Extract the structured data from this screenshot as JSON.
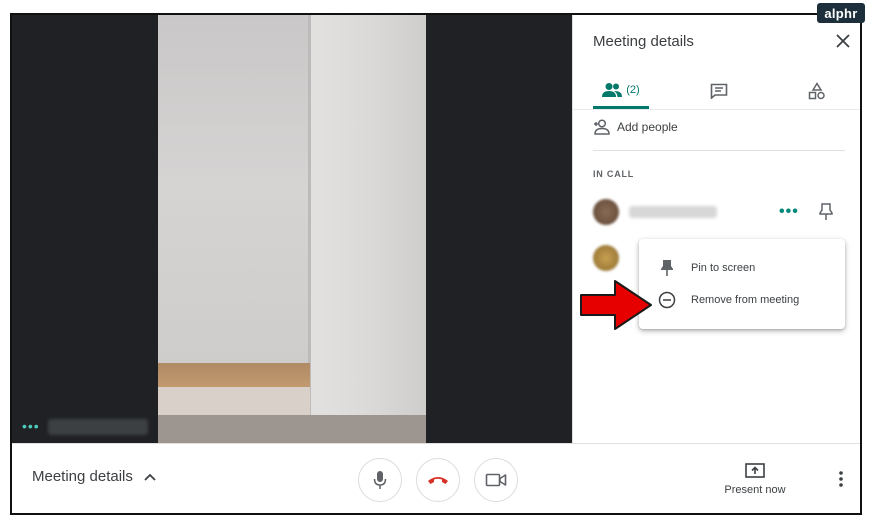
{
  "watermark": "alphr",
  "stage": {
    "participant_dots": "•••"
  },
  "panel": {
    "title": "Meeting details",
    "tabs": {
      "people_count": "(2)"
    },
    "add_people_label": "Add people",
    "section_label": "IN CALL",
    "more_dots": "•••",
    "menu": {
      "pin_label": "Pin to screen",
      "remove_label": "Remove from meeting"
    }
  },
  "bottom_bar": {
    "meeting_details_label": "Meeting details",
    "present_label": "Present now"
  },
  "colors": {
    "accent": "#00796b",
    "end_call": "#d93025",
    "arrow": "#e60000"
  },
  "icons": [
    "close-icon",
    "people-icon",
    "chat-icon",
    "activities-icon",
    "add-person-icon",
    "pin-icon",
    "remove-circle-icon",
    "chevron-up-icon",
    "mic-icon",
    "end-call-icon",
    "camera-icon",
    "present-icon",
    "more-vert-icon"
  ]
}
